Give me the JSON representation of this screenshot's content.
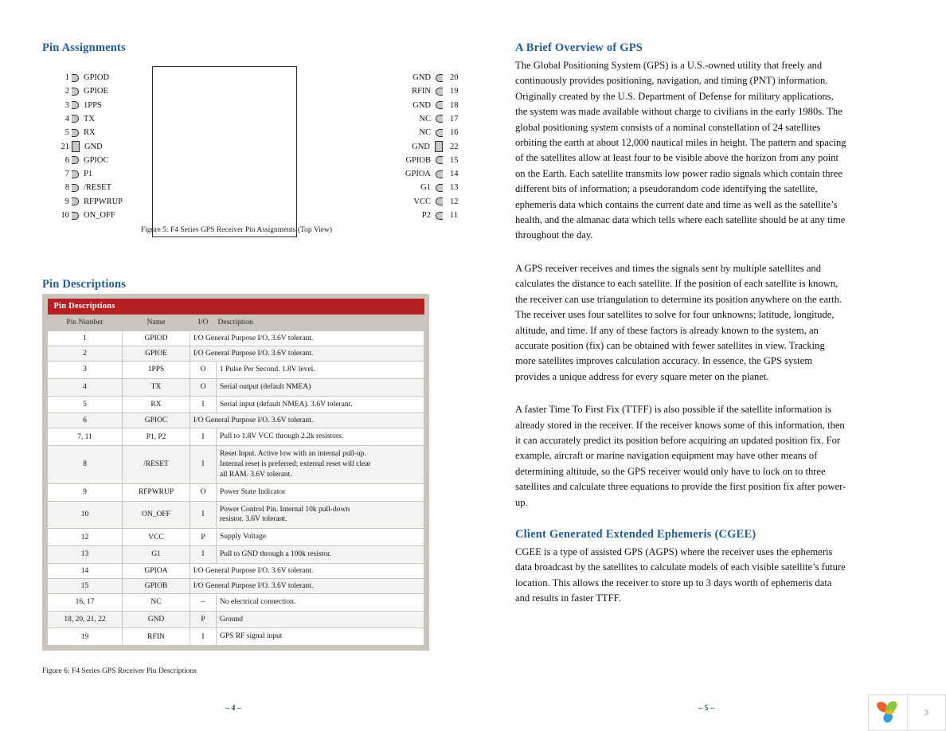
{
  "left": {
    "pin_assignments_heading": "Pin Assignments",
    "pin_descriptions_heading": "Pin Descriptions",
    "figure5_caption": "Figure 5: F4 Series GPS Receiver Pin Assignments (Top View)",
    "figure6_caption": "Figure 6: F4 Series GPS Receiver Pin Descriptions",
    "diagram": {
      "rows": [
        {
          "ln": "1",
          "ll": "GPIOD",
          "rl": "GND",
          "rn": "20",
          "big": false
        },
        {
          "ln": "2",
          "ll": "GPIOE",
          "rl": "RFIN",
          "rn": "19",
          "big": false
        },
        {
          "ln": "3",
          "ll": "1PPS",
          "rl": "GND",
          "rn": "18",
          "big": false
        },
        {
          "ln": "4",
          "ll": "TX",
          "rl": "NC",
          "rn": "17",
          "big": false
        },
        {
          "ln": "5",
          "ll": "RX",
          "rl": "NC",
          "rn": "16",
          "big": false
        },
        {
          "ln": "21",
          "ll": "GND",
          "rl": "GND",
          "rn": "22",
          "big": true
        },
        {
          "ln": "6",
          "ll": "GPIOC",
          "rl": "GPIOB",
          "rn": "15",
          "big": false
        },
        {
          "ln": "7",
          "ll": "P1",
          "rl": "GPIOA",
          "rn": "14",
          "big": false
        },
        {
          "ln": "8",
          "ll": "/RESET",
          "rl": "G1",
          "rn": "13",
          "big": false
        },
        {
          "ln": "9",
          "ll": "RFPWRUP",
          "rl": "VCC",
          "rn": "12",
          "big": false
        },
        {
          "ln": "10",
          "ll": "ON_OFF",
          "rl": "P2",
          "rn": "11",
          "big": false
        }
      ]
    },
    "table": {
      "title": "Pin Descriptions",
      "columns": [
        "Pin Number",
        "Name",
        "I/O",
        "Description"
      ],
      "rows": [
        {
          "pin": "1",
          "name": "GPIOD",
          "io": "I/O",
          "merged": true,
          "desc": [
            "I/O  General Purpose I/O. 3.6V tolerant."
          ]
        },
        {
          "pin": "2",
          "name": "GPIOE",
          "io": "I/O",
          "merged": true,
          "desc": [
            "I/O  General Purpose I/O. 3.6V tolerant."
          ]
        },
        {
          "pin": "3",
          "name": "1PPS",
          "io": "O",
          "merged": false,
          "desc": [
            "1 Pulse Per Second. 1.8V level."
          ]
        },
        {
          "pin": "4",
          "name": "TX",
          "io": "O",
          "merged": false,
          "desc": [
            "Serial output (default NMEA)"
          ]
        },
        {
          "pin": "5",
          "name": "RX",
          "io": "I",
          "merged": false,
          "desc": [
            "Serial input (default NMEA). 3.6V tolerant."
          ]
        },
        {
          "pin": "6",
          "name": "GPIOC",
          "io": "I/O",
          "merged": true,
          "desc": [
            "I/O  General Purpose I/O. 3.6V tolerant."
          ]
        },
        {
          "pin": "7, 11",
          "name": "P1, P2",
          "io": "I",
          "merged": false,
          "desc": [
            "Pull to 1.8V VCC through 2.2k resistors."
          ]
        },
        {
          "pin": "8",
          "name": "/RESET",
          "io": "I",
          "merged": false,
          "desc": [
            "Reset Input. Active low with an internal pull-up.",
            "Internal reset is preferred; external reset will clear",
            "all RAM. 3.6V tolerant."
          ]
        },
        {
          "pin": "9",
          "name": "RFPWRUP",
          "io": "O",
          "merged": false,
          "desc": [
            "Power State Indicator"
          ]
        },
        {
          "pin": "10",
          "name": "ON_OFF",
          "io": "I",
          "merged": false,
          "desc": [
            "Power Control Pin. Internal 10k pull-down",
            "resistor. 3.6V tolerant."
          ]
        },
        {
          "pin": "12",
          "name": "VCC",
          "io": "P",
          "merged": false,
          "desc": [
            "Supply Voltage"
          ]
        },
        {
          "pin": "13",
          "name": "G1",
          "io": "I",
          "merged": false,
          "desc": [
            "Pull to GND through a 100k resistor."
          ]
        },
        {
          "pin": "14",
          "name": "GPIOA",
          "io": "I/O",
          "merged": true,
          "desc": [
            "I/O  General Purpose I/O. 3.6V tolerant."
          ]
        },
        {
          "pin": "15",
          "name": "GPIOB",
          "io": "I/O",
          "merged": true,
          "desc": [
            "I/O  General Purpose I/O. 3.6V tolerant."
          ]
        },
        {
          "pin": "16, 17",
          "name": "NC",
          "io": "–",
          "merged": false,
          "desc": [
            "No electrical connection."
          ]
        },
        {
          "pin": "18, 20, 21, 22",
          "name": "GND",
          "io": "P",
          "merged": false,
          "desc": [
            "Ground"
          ]
        },
        {
          "pin": "19",
          "name": "RFIN",
          "io": "I",
          "merged": false,
          "desc": [
            "GPS RF signal input"
          ]
        }
      ]
    }
  },
  "right": {
    "gps_overview_heading": "A Brief Overview of GPS",
    "gps_overview_para1": "The Global Positioning System (GPS) is a U.S.-owned utility that freely and continuously provides positioning, navigation, and timing (PNT) information. Originally created by the U.S. Department of Defense for military applications, the system was made available without charge to civilians in the early 1980s. The global positioning system consists of a nominal constellation of 24 satellites orbiting the earth at about 12,000 nautical miles in height. The pattern and spacing of the satellites allow at least four to be visible above the horizon from any point on the Earth. Each satellite transmits low power radio signals which contain three different bits of information; a pseudorandom code identifying the satellite, ephemeris data which contains the current date and time as well as the satellite’s health, and the almanac data which tells where each satellite should be at any time throughout the day.",
    "gps_overview_para2": "A GPS receiver receives and times the signals sent by multiple satellites and calculates the distance to each satellite. If the position of each satellite is known, the receiver can use triangulation to determine its position anywhere on the earth. The receiver uses four satellites to solve for four unknowns; latitude, longitude, altitude, and time. If any of these factors is already known to the system, an accurate position (fix) can be obtained with fewer satellites in view. Tracking more satellites improves calculation accuracy. In essence, the GPS system provides a unique address for every square meter on the planet.",
    "gps_overview_para3": "A faster Time To First Fix (TTFF) is also possible if the satellite information is already stored in the receiver. If the receiver knows some of this information, then it can accurately predict its position before acquiring an updated position fix. For example, aircraft or marine navigation equipment may have other means of determining altitude, so the GPS receiver would only have to lock on to three satellites and calculate three equations to provide the first position fix after power-up.",
    "cgee_heading": "Client Generated Extended Ephemeris (CGEE)",
    "cgee_para": "CGEE is a type of assisted GPS (AGPS) where the receiver uses the ephemeris data broadcast by the satellites to calculate models of each visible satellite’s future location. This allows the receiver to store up to 3 days worth of ephemeris data and results in faster TTFF."
  },
  "footer": {
    "left_page": "–  4  –",
    "right_page": "–  5  –",
    "next_page_arrow": "›"
  },
  "colors": {
    "heading_blue": "#1f5c99",
    "table_title_red": "#b51f24",
    "table_border_taupe": "#cbc4bd",
    "alt_row": "#f4f3f1"
  }
}
